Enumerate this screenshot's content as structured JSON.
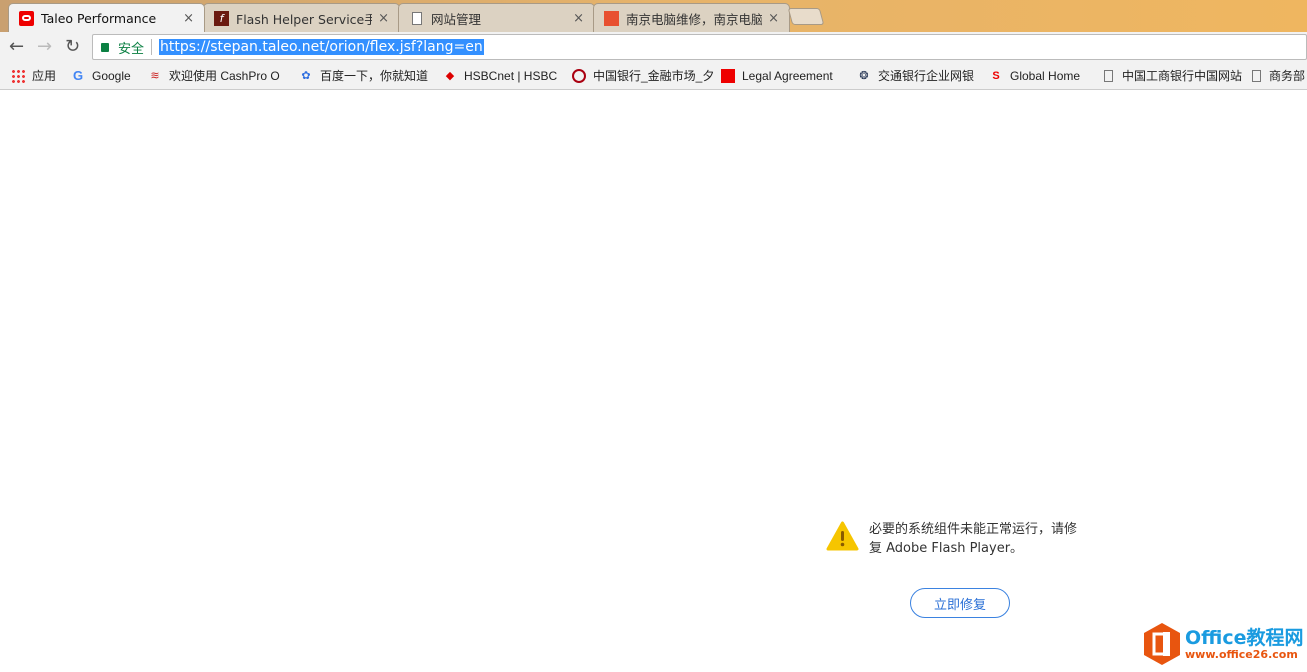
{
  "tabs": [
    {
      "title": "Taleo Performance",
      "icon": "oracle-icon",
      "active": true
    },
    {
      "title": "Flash Helper Service手动",
      "icon": "flash-icon",
      "active": false
    },
    {
      "title": "网站管理",
      "icon": "page-icon",
      "active": false
    },
    {
      "title": "南京电脑维修，南京电脑",
      "icon": "site-icon",
      "active": false
    }
  ],
  "tab_close": "×",
  "address": {
    "secure_label": "安全",
    "url": "https://stepan.taleo.net/orion/flex.jsf?lang=en"
  },
  "bookmarks": [
    {
      "label": "应用",
      "icon": "apps-icon"
    },
    {
      "label": "Google",
      "icon": "google-icon"
    },
    {
      "label": "欢迎使用 CashPro O",
      "icon": "bofa-icon"
    },
    {
      "label": "百度一下，你就知道",
      "icon": "baidu-icon"
    },
    {
      "label": "HSBCnet | HSBC",
      "icon": "hsbc-icon"
    },
    {
      "label": "中国银行_金融市场_夕",
      "icon": "boc-icon"
    },
    {
      "label": "Legal Agreement",
      "icon": "oracle-icon"
    },
    {
      "label": "交通银行企业网银",
      "icon": "bocom-icon"
    },
    {
      "label": "Global Home",
      "icon": "santander-icon"
    },
    {
      "label": "中国工商银行中国网站",
      "icon": "page-icon"
    },
    {
      "label": "商务部",
      "icon": "page-icon"
    }
  ],
  "flash": {
    "message": "必要的系统组件未能正常运行，请修复 Adobe Flash Player。",
    "button": "立即修复"
  },
  "watermark": {
    "title": "Office教程网",
    "url": "www.office26.com"
  },
  "colors": {
    "accent": "#2a6fd6",
    "warning": "#f6c500",
    "oracle": "#e00"
  }
}
